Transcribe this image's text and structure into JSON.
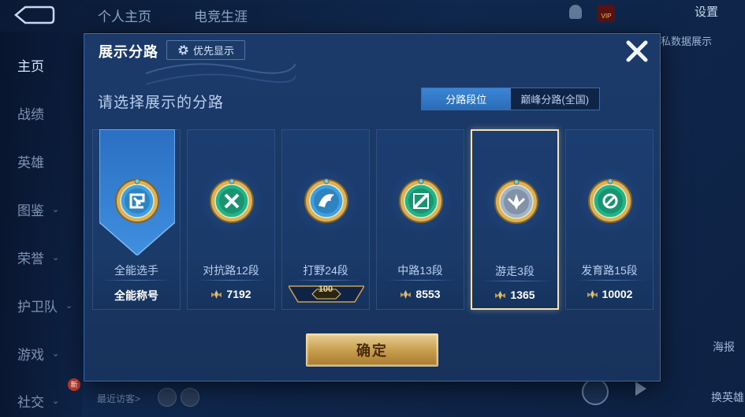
{
  "background": {
    "top_tabs": [
      "个人主页",
      "电竞生涯"
    ],
    "settings_label": "设置",
    "right_data_label": "私数据展示",
    "vip_label": "VIP",
    "sidebar": [
      {
        "label": "主页",
        "active": true,
        "chevron": false
      },
      {
        "label": "战绩",
        "active": false,
        "chevron": false
      },
      {
        "label": "英雄",
        "active": false,
        "chevron": false
      },
      {
        "label": "图鉴",
        "active": false,
        "chevron": true
      },
      {
        "label": "荣誉",
        "active": false,
        "chevron": true
      },
      {
        "label": "护卫队",
        "active": false,
        "chevron": true
      },
      {
        "label": "游戏",
        "active": false,
        "chevron": true
      },
      {
        "label": "社交",
        "active": false,
        "chevron": true
      }
    ],
    "new_badge": "新",
    "visitors_label": "最近访客>",
    "right_bottom_1": "海报",
    "right_bottom_2": "换英雄"
  },
  "modal": {
    "title": "展示分路",
    "priority_button": "优先显示",
    "subtitle": "请选择展示的分路",
    "toggle": [
      "分路段位",
      "巅峰分路(全国)"
    ],
    "toggle_active": 0,
    "cards": [
      {
        "name": "全能选手",
        "value": "全能称号",
        "show_point_icon": false,
        "emblem": "all-round-emblem-icon",
        "color": "#3aa0e8",
        "banner": true,
        "selected": false,
        "rank_tag": ""
      },
      {
        "name": "对抗路12段",
        "value": "7192",
        "show_point_icon": true,
        "emblem": "clash-lane-emblem-icon",
        "color": "#1fb58a",
        "banner": false,
        "selected": false,
        "rank_tag": ""
      },
      {
        "name": "打野24段",
        "value": "",
        "show_point_icon": false,
        "emblem": "jungle-emblem-icon",
        "color": "#3aa0e8",
        "banner": false,
        "selected": false,
        "rank_tag": "100"
      },
      {
        "name": "中路13段",
        "value": "8553",
        "show_point_icon": true,
        "emblem": "mid-lane-emblem-icon",
        "color": "#1fb58a",
        "banner": false,
        "selected": false,
        "rank_tag": ""
      },
      {
        "name": "游走3段",
        "value": "1365",
        "show_point_icon": true,
        "emblem": "roam-emblem-icon",
        "color": "#9fb3cc",
        "banner": false,
        "selected": true,
        "rank_tag": ""
      },
      {
        "name": "发育路15段",
        "value": "10002",
        "show_point_icon": true,
        "emblem": "farm-lane-emblem-icon",
        "color": "#1fb58a",
        "banner": false,
        "selected": false,
        "rank_tag": ""
      }
    ],
    "confirm_button": "确定"
  }
}
